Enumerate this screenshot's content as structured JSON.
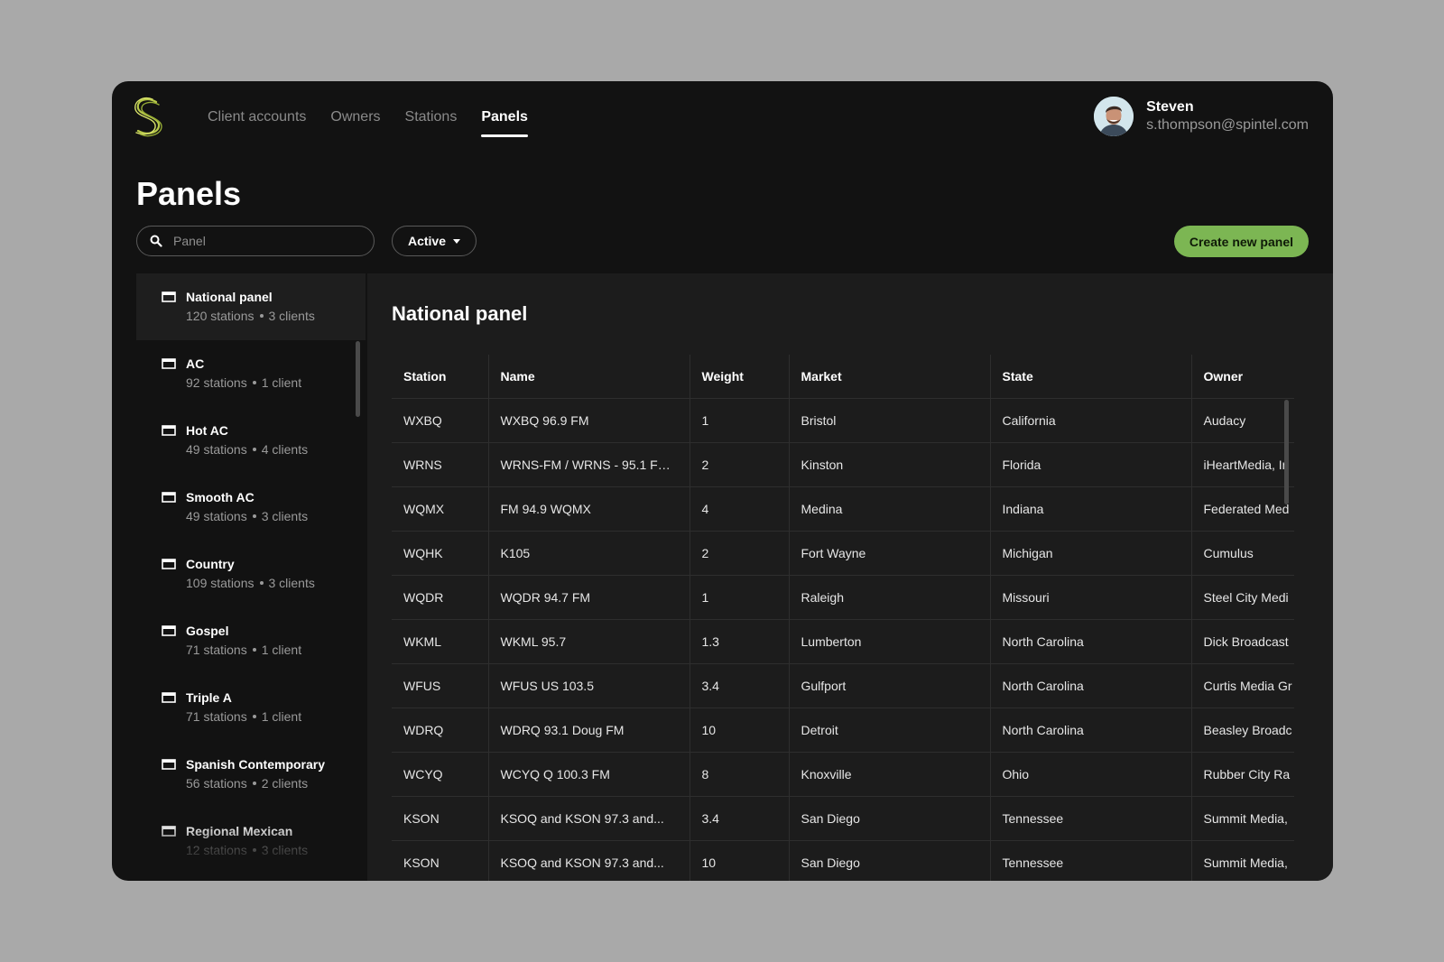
{
  "nav": {
    "items": [
      {
        "label": "Client accounts",
        "active": false
      },
      {
        "label": "Owners",
        "active": false
      },
      {
        "label": "Stations",
        "active": false
      },
      {
        "label": "Panels",
        "active": true
      }
    ]
  },
  "user": {
    "name": "Steven",
    "email": "s.thompson@spintel.com"
  },
  "page": {
    "title": "Panels"
  },
  "search": {
    "placeholder": "Panel",
    "value": ""
  },
  "filter": {
    "label": "Active"
  },
  "create_button": {
    "label": "Create new panel"
  },
  "sidebar": {
    "items": [
      {
        "name": "National panel",
        "stations": "120 stations",
        "clients": "3 clients",
        "selected": true
      },
      {
        "name": "AC",
        "stations": "92 stations",
        "clients": "1 client"
      },
      {
        "name": "Hot AC",
        "stations": "49 stations",
        "clients": "4 clients"
      },
      {
        "name": "Smooth AC",
        "stations": "49 stations",
        "clients": "3 clients"
      },
      {
        "name": "Country",
        "stations": "109 stations",
        "clients": "3 clients"
      },
      {
        "name": "Gospel",
        "stations": "71 stations",
        "clients": "1 client"
      },
      {
        "name": "Triple A",
        "stations": "71 stations",
        "clients": "1 client"
      },
      {
        "name": "Spanish Contemporary",
        "stations": "56 stations",
        "clients": "2 clients"
      },
      {
        "name": "Regional Mexican",
        "stations": "12 stations",
        "clients": "3 clients"
      }
    ]
  },
  "detail": {
    "title": "National panel",
    "columns": [
      "Station",
      "Name",
      "Weight",
      "Market",
      "State",
      "Owner"
    ],
    "rows": [
      [
        "WXBQ",
        "WXBQ 96.9 FM",
        "1",
        "Bristol",
        "California",
        "Audacy"
      ],
      [
        "WRNS",
        "WRNS-FM / WRNS - 95.1 FM...",
        "2",
        "Kinston",
        "Florida",
        "iHeartMedia, In"
      ],
      [
        "WQMX",
        "FM 94.9 WQMX",
        "4",
        "Medina",
        "Indiana",
        "Federated Med"
      ],
      [
        "WQHK",
        "K105",
        "2",
        "Fort Wayne",
        "Michigan",
        "Cumulus"
      ],
      [
        "WQDR",
        "WQDR 94.7 FM",
        "1",
        "Raleigh",
        "Missouri",
        "Steel City Medi"
      ],
      [
        "WKML",
        "WKML 95.7",
        "1.3",
        "Lumberton",
        "North Carolina",
        "Dick Broadcast"
      ],
      [
        "WFUS",
        "WFUS US 103.5",
        "3.4",
        "Gulfport",
        "North Carolina",
        "Curtis Media Gr"
      ],
      [
        "WDRQ",
        "WDRQ 93.1 Doug FM",
        "10",
        "Detroit",
        "North Carolina",
        "Beasley Broadc"
      ],
      [
        "WCYQ",
        "WCYQ Q 100.3 FM",
        "8",
        "Knoxville",
        "Ohio",
        "Rubber City Ra"
      ],
      [
        "KSON",
        "KSOQ and KSON 97.3 and...",
        "3.4",
        "San Diego",
        "Tennessee",
        "Summit Media,"
      ],
      [
        "KSON",
        "KSOQ and KSON 97.3 and...",
        "10",
        "San Diego",
        "Tennessee",
        "Summit Media,"
      ]
    ]
  },
  "colors": {
    "accent": "#7cb653",
    "background": "#121212",
    "surface": "#1c1c1c"
  },
  "icons": {
    "logo": "spintel-logo",
    "search": "search-icon",
    "panel": "panel-window-icon",
    "dropdown": "caret-down-icon"
  }
}
